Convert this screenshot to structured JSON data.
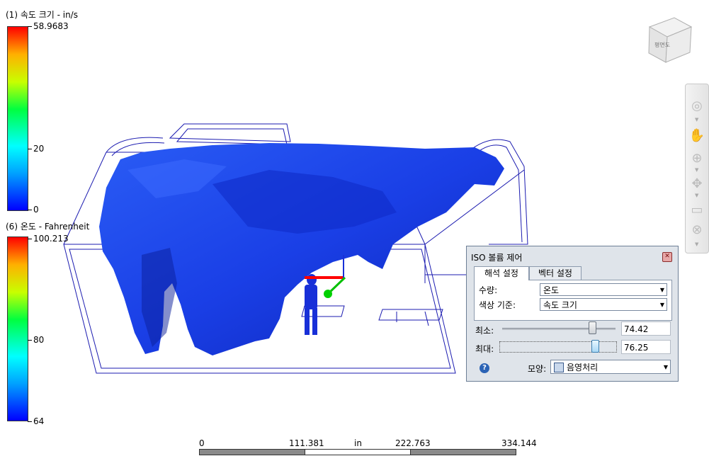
{
  "legend_velocity": {
    "title": "(1) 속도 크기 - in/s",
    "max": "58.9683",
    "mid": "20",
    "min": "0"
  },
  "legend_temperature": {
    "title": "(6) 온도 - Fahrenheit",
    "max": "100.213",
    "mid": "80",
    "min": "64"
  },
  "view_cube": {
    "face_label": "평면도",
    "icon": "view-cube-icon"
  },
  "nav_bar": {
    "tools": [
      "steering-wheel-icon",
      "pan-hand-icon",
      "zoom-icon",
      "orbit-icon",
      "look-icon",
      "rewind-icon"
    ]
  },
  "iso_dialog": {
    "title": "ISO 볼륨 제어",
    "tabs": [
      {
        "label": "해석 설정",
        "active": true
      },
      {
        "label": "벡터 설정",
        "active": false
      }
    ],
    "quantity_label": "수량:",
    "quantity_value": "온도",
    "color_basis_label": "색상 기준:",
    "color_basis_value": "속도 크기",
    "min_label": "최소:",
    "min_value": "74.42",
    "max_label": "최대:",
    "max_value": "76.25",
    "shape_label": "모양:",
    "shape_value": "음영처리",
    "help_icon": "help-icon"
  },
  "scale": {
    "labels": [
      "0",
      "111.381",
      "in",
      "222.763",
      "334.144"
    ]
  },
  "colors": {
    "iso_surface": "#1a3fe6",
    "wireframe": "#1b1bb0",
    "axis_x": "#ff0000",
    "axis_y": "#00c000"
  }
}
